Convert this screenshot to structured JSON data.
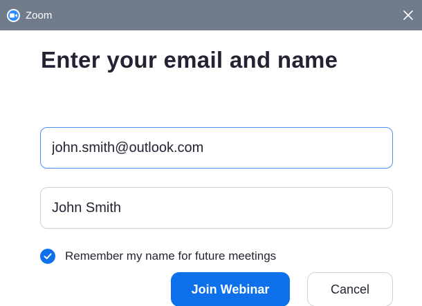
{
  "window": {
    "title": "Zoom",
    "app_icon": "zoom-camera-icon",
    "close_icon": "close-icon"
  },
  "dialog": {
    "heading": "Enter your email and name",
    "email_value": "john.smith@outlook.com",
    "name_value": "John Smith",
    "remember": {
      "checked": true,
      "label": "Remember my name for future meetings"
    },
    "join_button_label": "Join Webinar",
    "cancel_button_label": "Cancel"
  },
  "colors": {
    "titlebar": "#707b8c",
    "accent": "#0e71eb",
    "focus_border": "#4a8ff0",
    "text": "#232333"
  }
}
